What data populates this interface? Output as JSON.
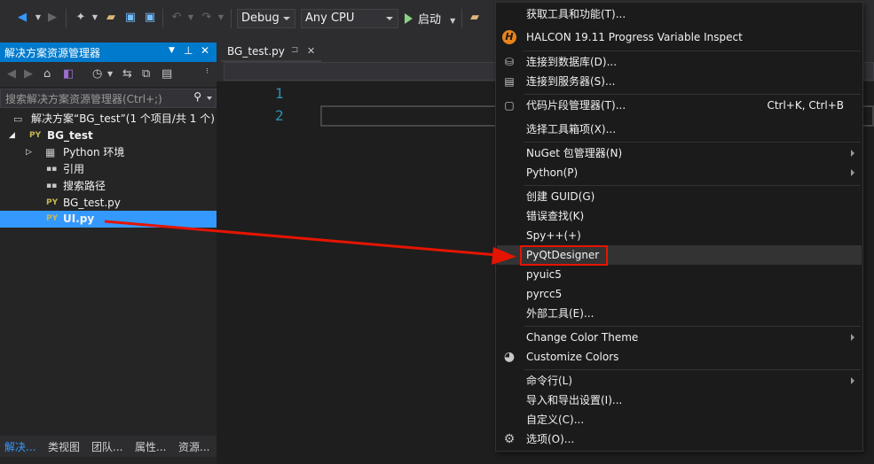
{
  "toolbar": {
    "config": "Debug",
    "platform": "Any CPU",
    "start_label": "启动"
  },
  "solution_explorer": {
    "title": "解决方案资源管理器",
    "search_placeholder": "搜索解决方案资源管理器(Ctrl+;)",
    "items": [
      {
        "label": "解决方案“BG_test”(1 个项目/共 1 个)",
        "icon": "solution-icon"
      },
      {
        "label": "BG_test",
        "icon": "python-project-icon"
      },
      {
        "label": "Python 环境",
        "icon": "environment-icon"
      },
      {
        "label": "引用",
        "icon": "references-icon"
      },
      {
        "label": "搜索路径",
        "icon": "search-path-icon"
      },
      {
        "label": "BG_test.py",
        "icon": "python-file-icon"
      },
      {
        "label": "UI.py",
        "icon": "python-file-icon"
      }
    ],
    "bottom_tabs": [
      "解决...",
      "类视图",
      "团队...",
      "属性...",
      "资源..."
    ]
  },
  "editor": {
    "tab_label": "BG_test.py",
    "line_numbers": [
      "1",
      "2"
    ]
  },
  "tools_menu": {
    "items": [
      {
        "label": "获取工具和功能(T)...",
        "shortcut": ""
      },
      {
        "label": "HALCON 19.11 Progress Variable Inspect",
        "shortcut": ""
      },
      {
        "label": "连接到数据库(D)...",
        "shortcut": ""
      },
      {
        "label": "连接到服务器(S)...",
        "shortcut": ""
      },
      {
        "label": "代码片段管理器(T)...",
        "shortcut": "Ctrl+K, Ctrl+B"
      },
      {
        "label": "选择工具箱项(X)...",
        "shortcut": ""
      },
      {
        "label": "NuGet 包管理器(N)",
        "shortcut": ""
      },
      {
        "label": "Python(P)",
        "shortcut": ""
      },
      {
        "label": "创建 GUID(G)",
        "shortcut": ""
      },
      {
        "label": "错误查找(K)",
        "shortcut": ""
      },
      {
        "label": "Spy++(+)",
        "shortcut": ""
      },
      {
        "label": "PyQtDesigner",
        "shortcut": ""
      },
      {
        "label": "pyuic5",
        "shortcut": ""
      },
      {
        "label": "pyrcc5",
        "shortcut": ""
      },
      {
        "label": "外部工具(E)...",
        "shortcut": ""
      },
      {
        "label": "Change Color Theme",
        "shortcut": ""
      },
      {
        "label": "Customize Colors",
        "shortcut": ""
      },
      {
        "label": "命令行(L)",
        "shortcut": ""
      },
      {
        "label": "导入和导出设置(I)...",
        "shortcut": ""
      },
      {
        "label": "自定义(C)...",
        "shortcut": ""
      },
      {
        "label": "选项(O)...",
        "shortcut": ""
      }
    ]
  },
  "colors": {
    "accent": "#007acc",
    "selection": "#3399ff",
    "highlight_box": "#e51400",
    "arrow": "#e51400"
  }
}
